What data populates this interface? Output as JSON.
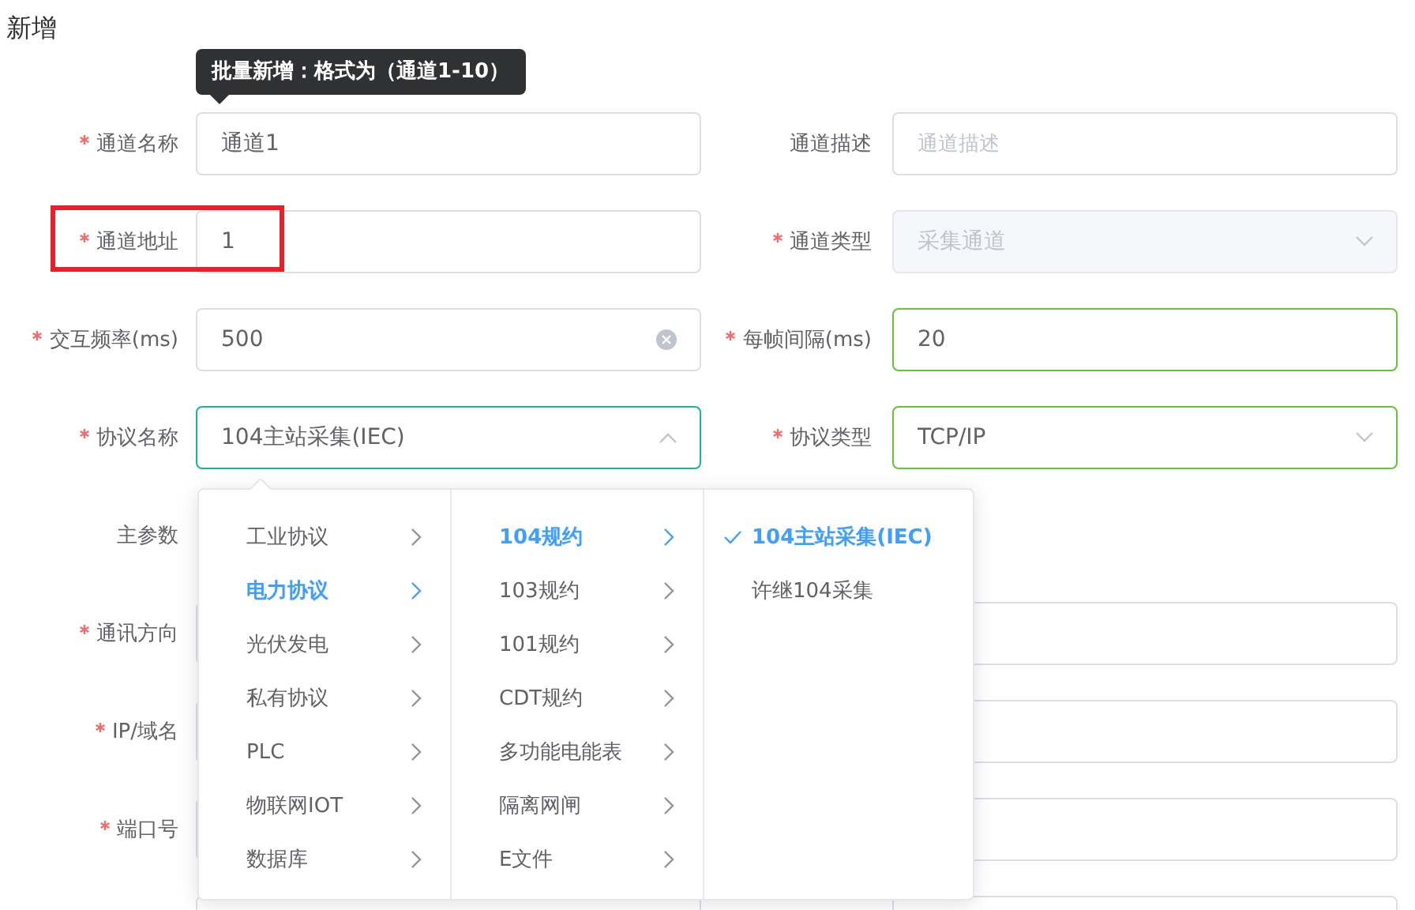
{
  "title": "新增",
  "tooltip": {
    "text": "批量新增：格式为（通道1-10）"
  },
  "form": {
    "rows": [
      {
        "fields": [
          {
            "kind": "input",
            "label": "通道名称",
            "required": true,
            "value": "通道1"
          },
          {
            "kind": "input",
            "label": "通道描述",
            "required": false,
            "placeholder": "通道描述"
          }
        ]
      },
      {
        "fields": [
          {
            "kind": "input",
            "label": "通道地址",
            "required": true,
            "value": "1",
            "highlighted": true
          },
          {
            "kind": "select",
            "label": "通道类型",
            "required": true,
            "value": "采集通道",
            "disabled": true,
            "expanded": false
          }
        ]
      },
      {
        "fields": [
          {
            "kind": "input",
            "label": "交互频率(ms)",
            "required": true,
            "value": "500",
            "clearable": true
          },
          {
            "kind": "input",
            "label": "每帧间隔(ms)",
            "required": true,
            "value": "20",
            "valid": true
          }
        ]
      },
      {
        "fields": [
          {
            "kind": "cascader",
            "label": "协议名称",
            "required": true,
            "value": "104主站采集(IEC)",
            "focused": true,
            "expanded": true,
            "menus": [
              {
                "items": [
                  {
                    "label": "工业协议",
                    "selected": false,
                    "has_children": true
                  },
                  {
                    "label": "电力协议",
                    "selected": true,
                    "has_children": true
                  },
                  {
                    "label": "光伏发电",
                    "selected": false,
                    "has_children": true
                  },
                  {
                    "label": "私有协议",
                    "selected": false,
                    "has_children": true
                  },
                  {
                    "label": "PLC",
                    "selected": false,
                    "has_children": true
                  },
                  {
                    "label": "物联网IOT",
                    "selected": false,
                    "has_children": true
                  },
                  {
                    "label": "数据库",
                    "selected": false,
                    "has_children": true
                  }
                ]
              },
              {
                "items": [
                  {
                    "label": "104规约",
                    "selected": true,
                    "has_children": true
                  },
                  {
                    "label": "103规约",
                    "selected": false,
                    "has_children": true
                  },
                  {
                    "label": "101规约",
                    "selected": false,
                    "has_children": true
                  },
                  {
                    "label": "CDT规约",
                    "selected": false,
                    "has_children": true
                  },
                  {
                    "label": "多功能电能表",
                    "selected": false,
                    "has_children": true
                  },
                  {
                    "label": "隔离网闸",
                    "selected": false,
                    "has_children": true
                  },
                  {
                    "label": "E文件",
                    "selected": false,
                    "has_children": true
                  }
                ]
              },
              {
                "items": [
                  {
                    "label": "104主站采集(IEC)",
                    "selected": true,
                    "has_children": false
                  },
                  {
                    "label": "许继104采集",
                    "selected": false,
                    "has_children": false
                  }
                ]
              }
            ]
          },
          {
            "kind": "select",
            "label": "协议类型",
            "required": true,
            "value": "TCP/IP",
            "valid": true,
            "expanded": false
          }
        ]
      },
      {
        "fields": [
          {
            "kind": "label_only",
            "label": "主参数",
            "required": false
          }
        ]
      },
      {
        "fields": [
          {
            "kind": "input",
            "label": "通讯方向",
            "required": true
          },
          {
            "kind": "input"
          }
        ]
      },
      {
        "fields": [
          {
            "kind": "input",
            "label": "IP/域名",
            "required": true
          },
          {
            "kind": "input"
          }
        ]
      },
      {
        "fields": [
          {
            "kind": "input",
            "label": "端口号",
            "required": true
          },
          {
            "kind": "input"
          }
        ]
      },
      {
        "fields": [
          {
            "kind": "input"
          },
          {
            "kind": "input"
          }
        ]
      }
    ]
  }
}
